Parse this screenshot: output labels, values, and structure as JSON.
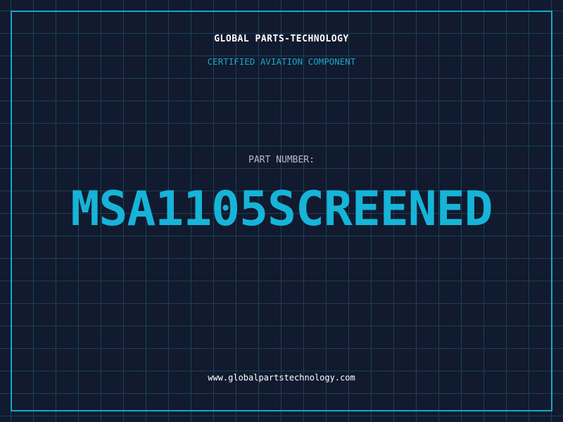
{
  "header": {
    "company_name": "GLOBAL PARTS-TECHNOLOGY",
    "subtitle": "CERTIFIED AVIATION COMPONENT"
  },
  "part": {
    "label": "PART NUMBER:",
    "number": "MSA1105SCREENED"
  },
  "footer": {
    "website": "www.globalpartstechnology.com"
  },
  "colors": {
    "background": "#111a2e",
    "grid": "#1d4154",
    "accent": "#16b4d8",
    "text": "#ffffff"
  }
}
